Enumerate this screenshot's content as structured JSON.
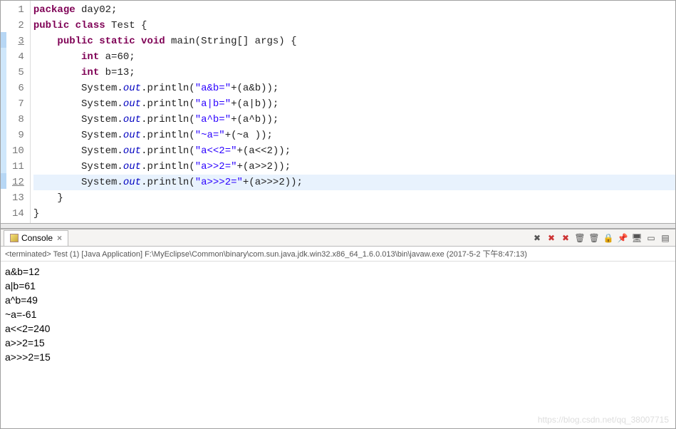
{
  "editor": {
    "linenos": [
      "1",
      "2",
      "3",
      "4",
      "5",
      "6",
      "7",
      "8",
      "9",
      "10",
      "11",
      "12",
      "13",
      "14"
    ],
    "annot_line": "3",
    "underline_lines": [
      "3",
      "12"
    ],
    "active_line": 12,
    "tokens": {
      "l1": {
        "seg": [
          [
            "kw",
            "package"
          ],
          [
            "plain",
            " day02;"
          ]
        ]
      },
      "l2": {
        "seg": [
          [
            "kw",
            "public class"
          ],
          [
            "plain",
            " Test {"
          ]
        ]
      },
      "l3": {
        "seg": [
          [
            "plain",
            "    "
          ],
          [
            "kw",
            "public static void"
          ],
          [
            "plain",
            " main(String[] args) {"
          ]
        ]
      },
      "l4": {
        "seg": [
          [
            "plain",
            "        "
          ],
          [
            "kw",
            "int"
          ],
          [
            "plain",
            " a=60;"
          ]
        ]
      },
      "l5": {
        "seg": [
          [
            "plain",
            "        "
          ],
          [
            "kw",
            "int"
          ],
          [
            "plain",
            " b=13;"
          ]
        ]
      },
      "l6": {
        "seg": [
          [
            "plain",
            "        System."
          ],
          [
            "fld",
            "out"
          ],
          [
            "plain",
            ".println("
          ],
          [
            "str",
            "\"a&b=\""
          ],
          [
            "plain",
            "+(a&b));"
          ]
        ]
      },
      "l7": {
        "seg": [
          [
            "plain",
            "        System."
          ],
          [
            "fld",
            "out"
          ],
          [
            "plain",
            ".println("
          ],
          [
            "str",
            "\"a|b=\""
          ],
          [
            "plain",
            "+(a|b));"
          ]
        ]
      },
      "l8": {
        "seg": [
          [
            "plain",
            "        System."
          ],
          [
            "fld",
            "out"
          ],
          [
            "plain",
            ".println("
          ],
          [
            "str",
            "\"a^b=\""
          ],
          [
            "plain",
            "+(a^b));"
          ]
        ]
      },
      "l9": {
        "seg": [
          [
            "plain",
            "        System."
          ],
          [
            "fld",
            "out"
          ],
          [
            "plain",
            ".println("
          ],
          [
            "str",
            "\"~a=\""
          ],
          [
            "plain",
            "+(~a ));"
          ]
        ]
      },
      "l10": {
        "seg": [
          [
            "plain",
            "        System."
          ],
          [
            "fld",
            "out"
          ],
          [
            "plain",
            ".println("
          ],
          [
            "str",
            "\"a<<2=\""
          ],
          [
            "plain",
            "+(a<<2));"
          ]
        ]
      },
      "l11": {
        "seg": [
          [
            "plain",
            "        System."
          ],
          [
            "fld",
            "out"
          ],
          [
            "plain",
            ".println("
          ],
          [
            "str",
            "\"a>>2=\""
          ],
          [
            "plain",
            "+(a>>2));"
          ]
        ]
      },
      "l12": {
        "seg": [
          [
            "plain",
            "        System."
          ],
          [
            "fld",
            "out"
          ],
          [
            "plain",
            ".println("
          ],
          [
            "str",
            "\"a>>>2=\""
          ],
          [
            "plain",
            "+(a>>>2));"
          ]
        ]
      },
      "l13": {
        "seg": [
          [
            "plain",
            "    }"
          ]
        ]
      },
      "l14": {
        "seg": [
          [
            "plain",
            "}"
          ]
        ]
      }
    }
  },
  "console": {
    "tab_label": "Console",
    "status": "<terminated> Test (1) [Java Application] F:\\MyEclipse\\Common\\binary\\com.sun.java.jdk.win32.x86_64_1.6.0.013\\bin\\javaw.exe (2017-5-2 下午8:47:13)",
    "output": [
      "a&b=12",
      "a|b=61",
      "a^b=49",
      "~a=-61",
      "a<<2=240",
      "a>>2=15",
      "a>>>2=15"
    ],
    "toolbar_icons": [
      "x-gray-icon",
      "x-red-icon",
      "x-red2-icon",
      "remove-icon",
      "remove-all-icon",
      "scroll-lock-icon",
      "pin-icon",
      "display-icon",
      "min-icon",
      "view-icon"
    ]
  },
  "watermark": "https://blog.csdn.net/qq_38007715"
}
